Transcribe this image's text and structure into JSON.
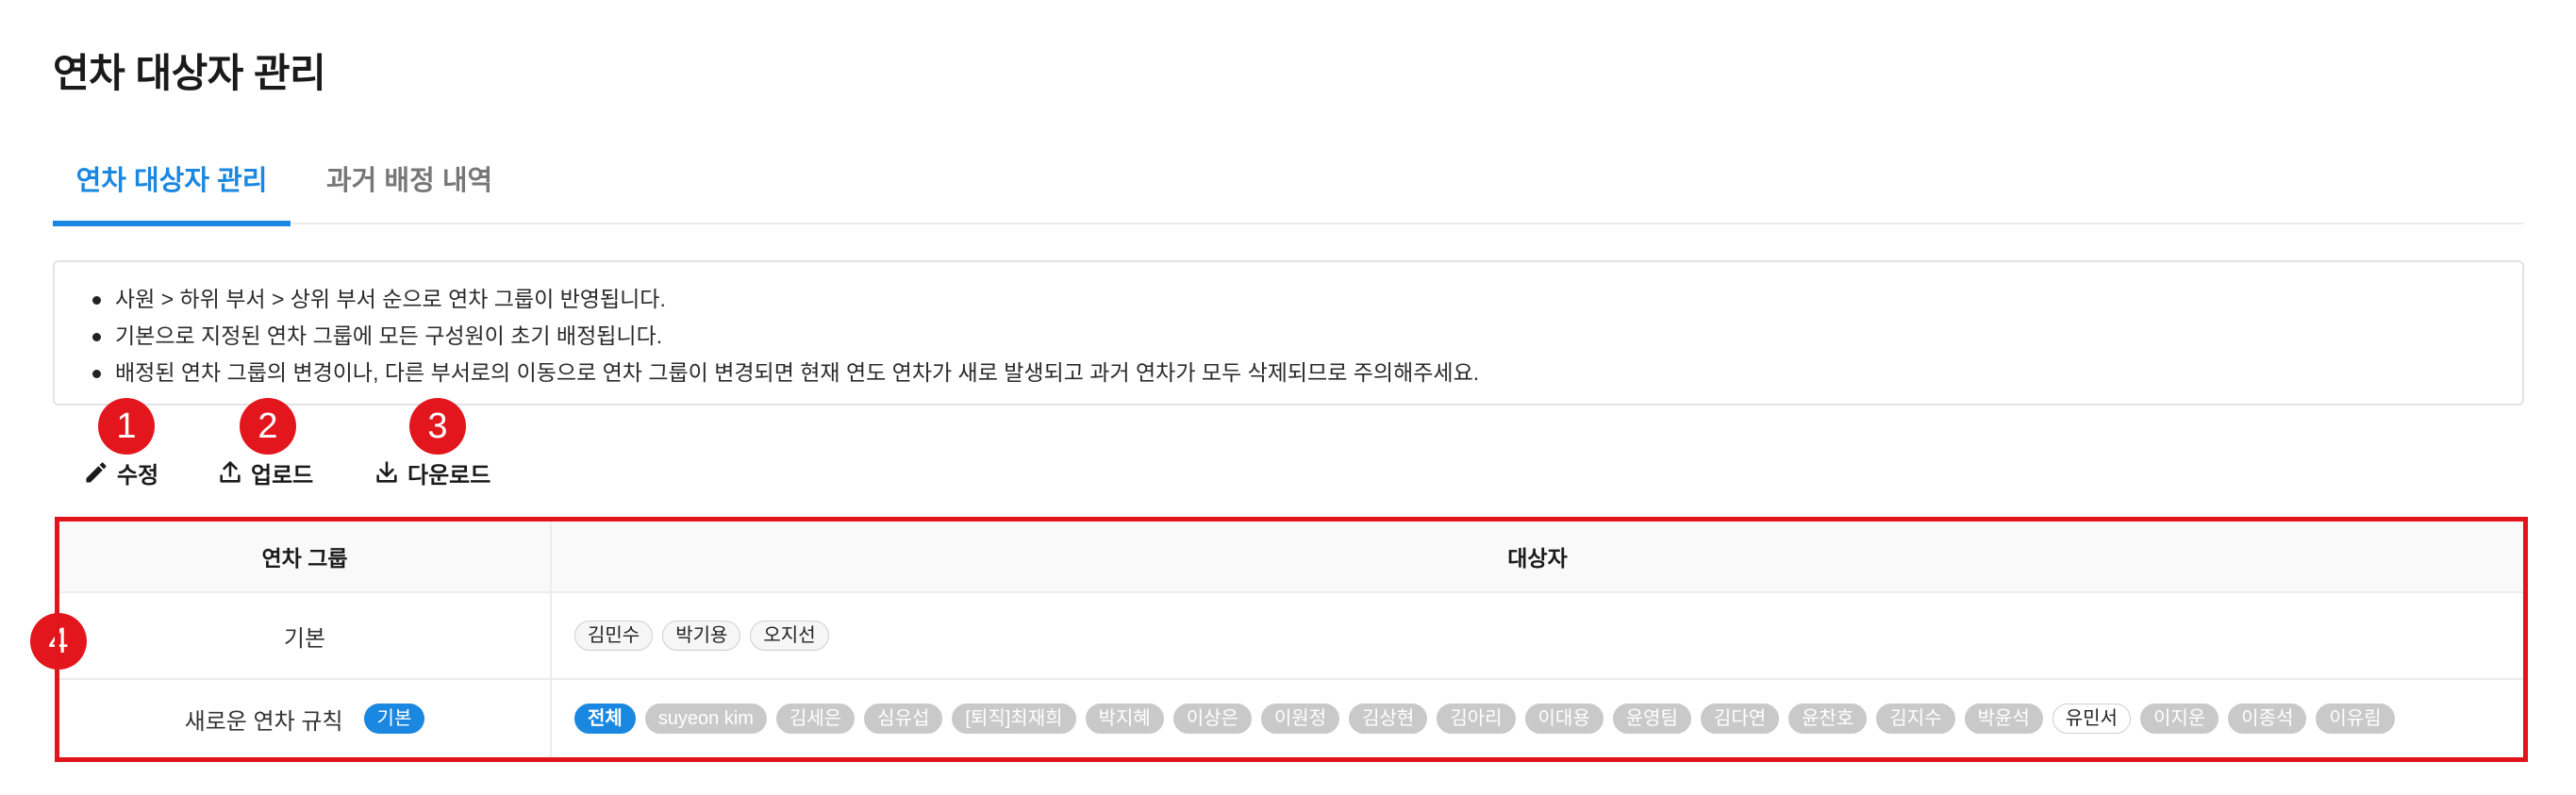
{
  "page": {
    "title": "연차 대상자 관리"
  },
  "tabs": [
    {
      "label": "연차 대상자 관리",
      "active": true
    },
    {
      "label": "과거 배정 내역",
      "active": false
    }
  ],
  "notice": {
    "items": [
      "사원 > 하위 부서 > 상위 부서 순으로 연차 그룹이 반영됩니다.",
      "기본으로 지정된 연차 그룹에 모든 구성원이 초기 배정됩니다.",
      "배정된 연차 그룹의 변경이나, 다른 부서로의 이동으로 연차 그룹이 변경되면 현재 연도 연차가 새로 발생되고 과거 연차가 모두 삭제되므로 주의해주세요."
    ]
  },
  "markers": [
    "1",
    "2",
    "3",
    "4"
  ],
  "toolbar": {
    "edit_label": "수정",
    "upload_label": "업로드",
    "download_label": "다운로드",
    "edit_icon": "pencil-icon",
    "upload_icon": "upload-icon",
    "download_icon": "download-icon"
  },
  "table": {
    "headers": [
      "연차 그룹",
      "대상자"
    ],
    "rows": [
      {
        "group": "기본",
        "badge": "",
        "members": [
          {
            "name": "김민수",
            "style": "outline"
          },
          {
            "name": "박기용",
            "style": "outline"
          },
          {
            "name": "오지선",
            "style": "outline"
          }
        ]
      },
      {
        "group": "새로운 연차 규칙",
        "badge": "기본",
        "members": [
          {
            "name": "전체",
            "style": "blue"
          },
          {
            "name": "suyeon kim",
            "style": "grey"
          },
          {
            "name": "김세은",
            "style": "grey"
          },
          {
            "name": "심유섭",
            "style": "grey"
          },
          {
            "name": "[퇴직]최재희",
            "style": "grey"
          },
          {
            "name": "박지혜",
            "style": "grey"
          },
          {
            "name": "이상은",
            "style": "grey"
          },
          {
            "name": "이원정",
            "style": "grey"
          },
          {
            "name": "김상현",
            "style": "grey"
          },
          {
            "name": "김아리",
            "style": "grey"
          },
          {
            "name": "이대용",
            "style": "grey"
          },
          {
            "name": "윤영팀",
            "style": "grey"
          },
          {
            "name": "김다연",
            "style": "grey"
          },
          {
            "name": "윤찬호",
            "style": "grey"
          },
          {
            "name": "김지수",
            "style": "grey"
          },
          {
            "name": "박윤석",
            "style": "grey"
          },
          {
            "name": "유민서",
            "style": "white"
          },
          {
            "name": "이지운",
            "style": "grey"
          },
          {
            "name": "이종석",
            "style": "grey"
          },
          {
            "name": "이유림",
            "style": "grey"
          }
        ]
      }
    ]
  },
  "colors": {
    "accent": "#1a87e0",
    "marker": "#e3161e",
    "chip_grey": "#c9c9c9"
  }
}
